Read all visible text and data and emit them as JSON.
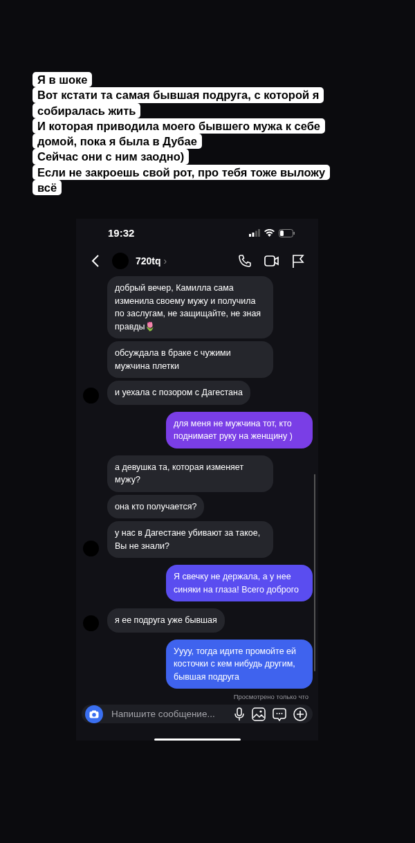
{
  "caption_lines": [
    "Я в шоке",
    "Вот кстати та самая бывшая подруга, с которой я",
    "собиралась жить",
    "И которая приводила моего бывшего мужа к себе",
    "домой, пока я была в Дубае",
    "Сейчас они с ним заодно)",
    "Если не закроешь свой рот, про тебя тоже выложу",
    "всё"
  ],
  "status_bar": {
    "time": "19:32"
  },
  "header": {
    "username": "720tq",
    "chevron": "›"
  },
  "messages": [
    {
      "kind": "incoming",
      "text": "добрый вечер, Камилла сама изменила своему мужу и получила по заслугам, не защищайте, не зная правды🌷"
    },
    {
      "kind": "incoming",
      "text": "обсуждала в браке с чужими мужчина плетки"
    },
    {
      "kind": "incoming",
      "avatar": true,
      "text": "и уехала с позором с Дагестана"
    },
    {
      "kind": "outgoing",
      "text": "для меня не мужчина тот, кто поднимает руку на женщину )"
    },
    {
      "kind": "incoming",
      "text": "а девушка та, которая изменяет мужу?"
    },
    {
      "kind": "incoming",
      "text": "она кто получается?"
    },
    {
      "kind": "incoming",
      "avatar": true,
      "text": "у нас в Дагестане убивают за такое, Вы не знали?"
    },
    {
      "kind": "outgoing",
      "text": "Я свечку не держала, а у нее синяки на глаза! Всего доброго"
    },
    {
      "kind": "incoming",
      "avatar": true,
      "text": "я ее подруга уже бывшая"
    },
    {
      "kind": "outgoing",
      "text": "Уууу, тогда идите промойте ей косточки с кем нибудь другим, бывшая подруга"
    }
  ],
  "seen_status": "Просмотрено только что",
  "composer": {
    "placeholder": "Напишите сообщение..."
  }
}
